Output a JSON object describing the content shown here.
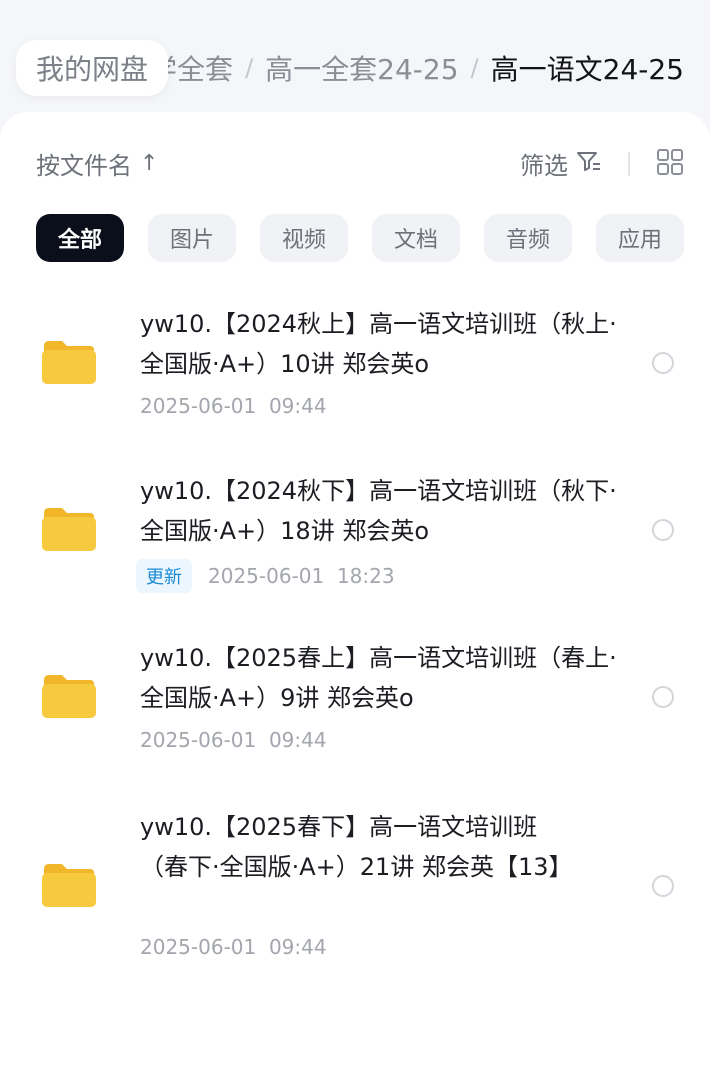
{
  "breadcrumb": {
    "home": "我的网盘",
    "items": [
      "学全套",
      "高一全套24-25"
    ],
    "current": "高一语文24-25",
    "separator": "/"
  },
  "toolbar": {
    "sort_label": "按文件名",
    "sort_arrow": "↑",
    "filter_label": "筛选",
    "view_icon": "grid-view-icon"
  },
  "chips": [
    "全部",
    "图片",
    "视频",
    "文档",
    "音频",
    "应用"
  ],
  "active_chip": "全部",
  "files": [
    {
      "name": "yw10.【2024秋上】高一语文培训班（秋上·全国版·A+）10讲 郑会英o",
      "date": "2025-06-01",
      "time": "09:44",
      "badge": ""
    },
    {
      "name": "yw10.【2024秋下】高一语文培训班（秋下·全国版·A+）18讲 郑会英o",
      "date": "2025-06-01",
      "time": "18:23",
      "badge": "更新"
    },
    {
      "name": "yw10.【2025春上】高一语文培训班（春上·全国版·A+）9讲 郑会英o",
      "date": "2025-06-01",
      "time": "09:44",
      "badge": ""
    },
    {
      "name": "yw10.【2025春下】高一语文培训班（春下·全国版·A+）21讲 郑会英【13】",
      "date": "2025-06-01",
      "time": "09:44",
      "badge": ""
    }
  ],
  "colors": {
    "folder": "#F7C93E",
    "accent_dark": "#0B0F1C",
    "badge_text": "#1A89D6"
  }
}
